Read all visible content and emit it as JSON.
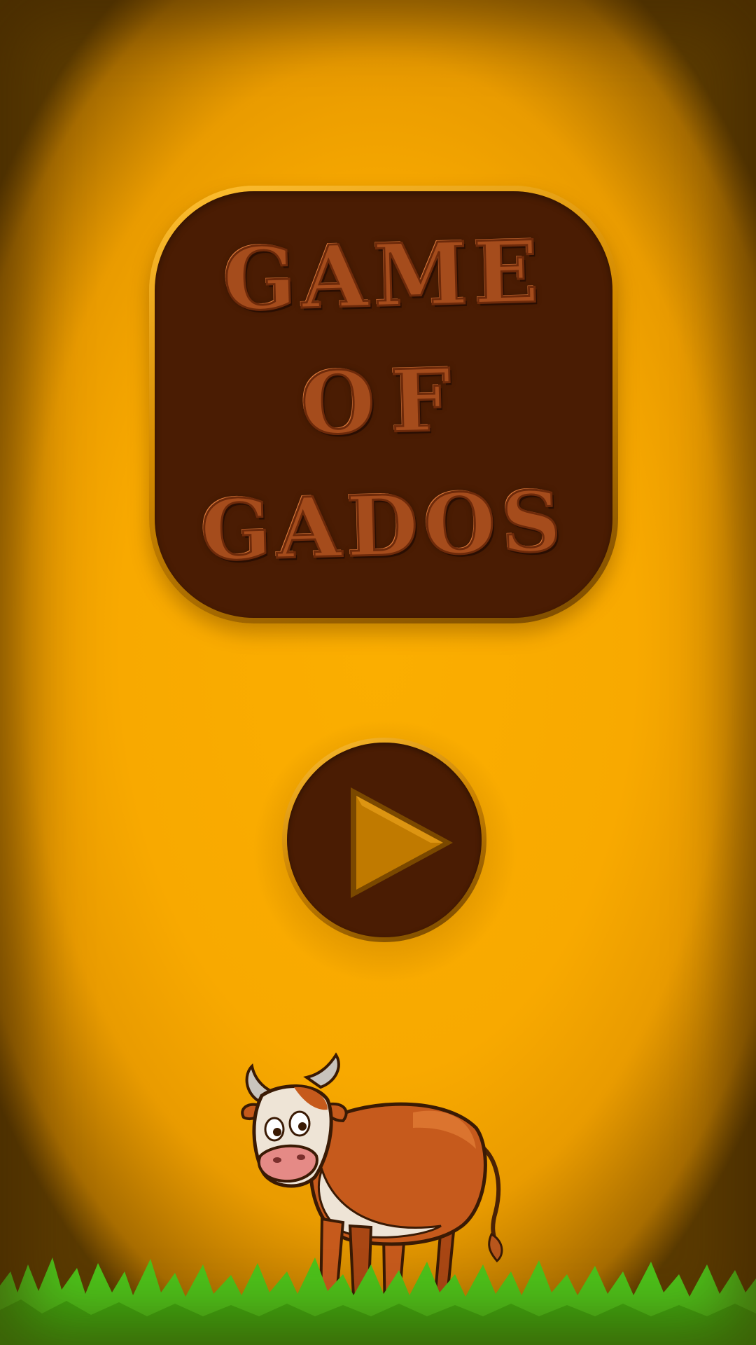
{
  "title": {
    "line1": "GAME",
    "line2": "OF",
    "line3": "GADOS"
  },
  "play_button": {
    "icon": "play-icon"
  },
  "scene": {
    "character": "cow-illustration",
    "ground": "grass"
  },
  "colors": {
    "background": "#f8a900",
    "plaque_fill": "#4a1c03",
    "plaque_rim": "#ffc033",
    "title_text": "#a54c1c",
    "play_triangle": "#c07a00",
    "grass": "#4cc21a"
  }
}
